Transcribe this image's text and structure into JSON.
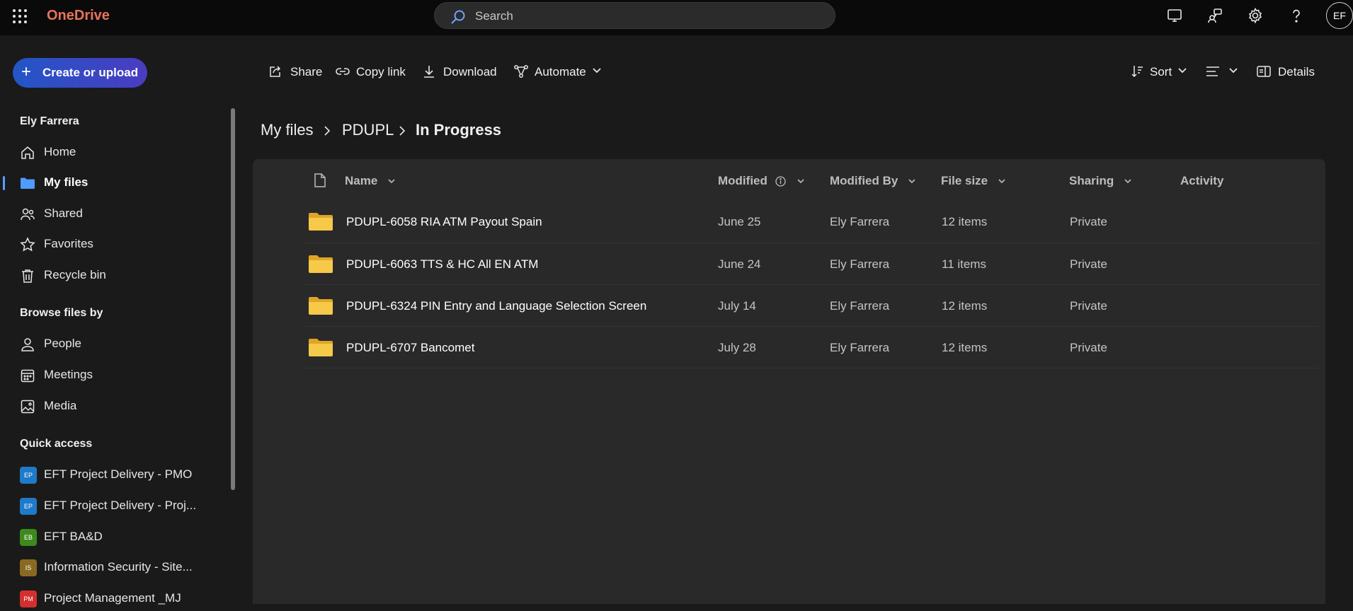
{
  "app": {
    "name": "OneDrive"
  },
  "search": {
    "placeholder": "Search"
  },
  "topbar": {
    "icons": [
      "monitor-icon",
      "share-people-icon",
      "settings-gear-icon",
      "help-icon"
    ],
    "avatar_initials": "EF"
  },
  "sidebar": {
    "create_label": "Create or upload",
    "user_name": "Ely Farrera",
    "nav_items": [
      {
        "label": "Home",
        "icon": "home-icon",
        "active": false
      },
      {
        "label": "My files",
        "icon": "folder-icon",
        "active": true
      },
      {
        "label": "Shared",
        "icon": "people-icon",
        "active": false
      },
      {
        "label": "Favorites",
        "icon": "star-icon",
        "active": false
      },
      {
        "label": "Recycle bin",
        "icon": "trash-icon",
        "active": false
      }
    ],
    "browse_heading": "Browse files by",
    "browse_items": [
      {
        "label": "People",
        "icon": "person-icon"
      },
      {
        "label": "Meetings",
        "icon": "calendar-icon"
      },
      {
        "label": "Media",
        "icon": "image-icon"
      }
    ],
    "quick_heading": "Quick access",
    "quick_items": [
      {
        "badge": "EP",
        "label": "EFT Project Delivery - PMO",
        "color": "#1f7ac9"
      },
      {
        "badge": "EP",
        "label": "EFT Project Delivery - Proj...",
        "color": "#1f7ac9"
      },
      {
        "badge": "EB",
        "label": "EFT BA&D",
        "color": "#3d8a1c"
      },
      {
        "badge": "IS",
        "label": "Information Security - Site...",
        "color": "#8a6a22"
      },
      {
        "badge": "PM",
        "label": "Project Management _MJ",
        "color": "#d42f2f"
      }
    ]
  },
  "commands": {
    "share": "Share",
    "copy_link": "Copy link",
    "download": "Download",
    "automate": "Automate",
    "sort": "Sort",
    "details": "Details"
  },
  "breadcrumb": [
    "My files",
    "PDUPL",
    "In Progress"
  ],
  "table": {
    "headers": {
      "name": "Name",
      "modified": "Modified",
      "modified_by": "Modified By",
      "file_size": "File size",
      "sharing": "Sharing",
      "activity": "Activity"
    },
    "rows": [
      {
        "name": "PDUPL-6058 RIA ATM Payout Spain",
        "modified": "June 25",
        "modified_by": "Ely Farrera",
        "size": "12 items",
        "sharing": "Private"
      },
      {
        "name": "PDUPL-6063 TTS & HC All EN ATM",
        "modified": "June 24",
        "modified_by": "Ely Farrera",
        "size": "11 items",
        "sharing": "Private"
      },
      {
        "name": "PDUPL-6324 PIN Entry and Language Selection Screen",
        "modified": "July 14",
        "modified_by": "Ely Farrera",
        "size": "12 items",
        "sharing": "Private"
      },
      {
        "name": "PDUPL-6707 Bancomet",
        "modified": "July 28",
        "modified_by": "Ely Farrera",
        "size": "12 items",
        "sharing": "Private"
      }
    ]
  },
  "colors": {
    "brand": "#e8745a",
    "accent": "#5b9bff",
    "folder": "#f5c34a"
  }
}
